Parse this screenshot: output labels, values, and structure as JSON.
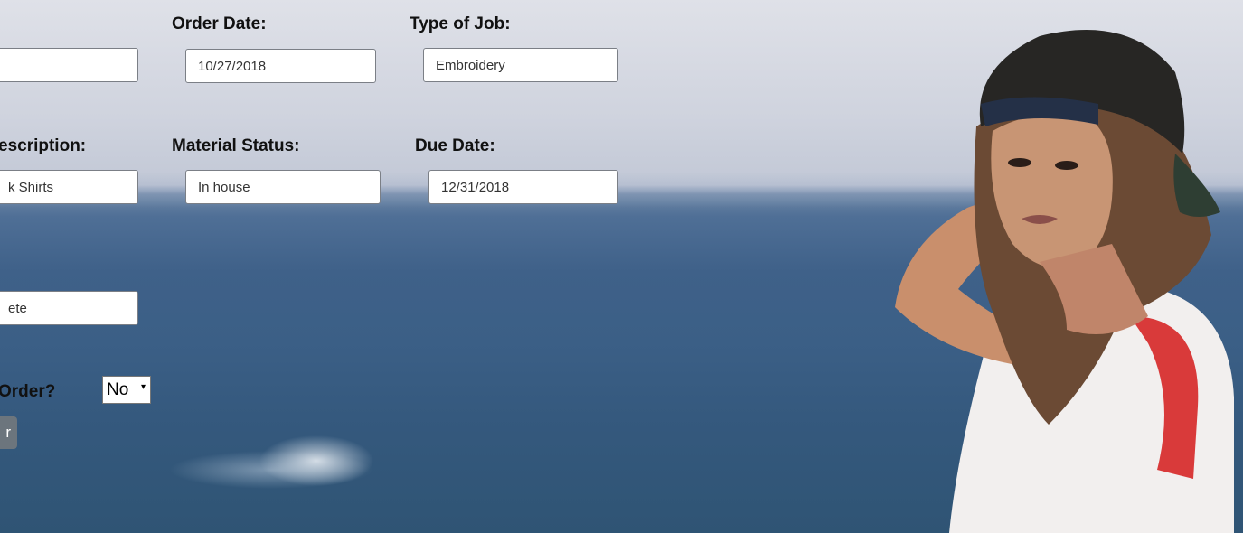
{
  "form": {
    "labels": {
      "order_date": "Order Date:",
      "type_of_job": "Type of Job:",
      "description": "escription:",
      "material_status": "Material Status:",
      "due_date": "Due Date:",
      "reorder": "Order?"
    },
    "fields": {
      "row1_col1": "",
      "order_date": "10/27/2018",
      "type_of_job": "Embroidery",
      "description": "k Shirts",
      "material_status": "In house",
      "due_date": "12/31/2018",
      "status": "ete"
    },
    "reorder_select": {
      "value": "No",
      "caret": "▾"
    },
    "submit_label": "r"
  }
}
